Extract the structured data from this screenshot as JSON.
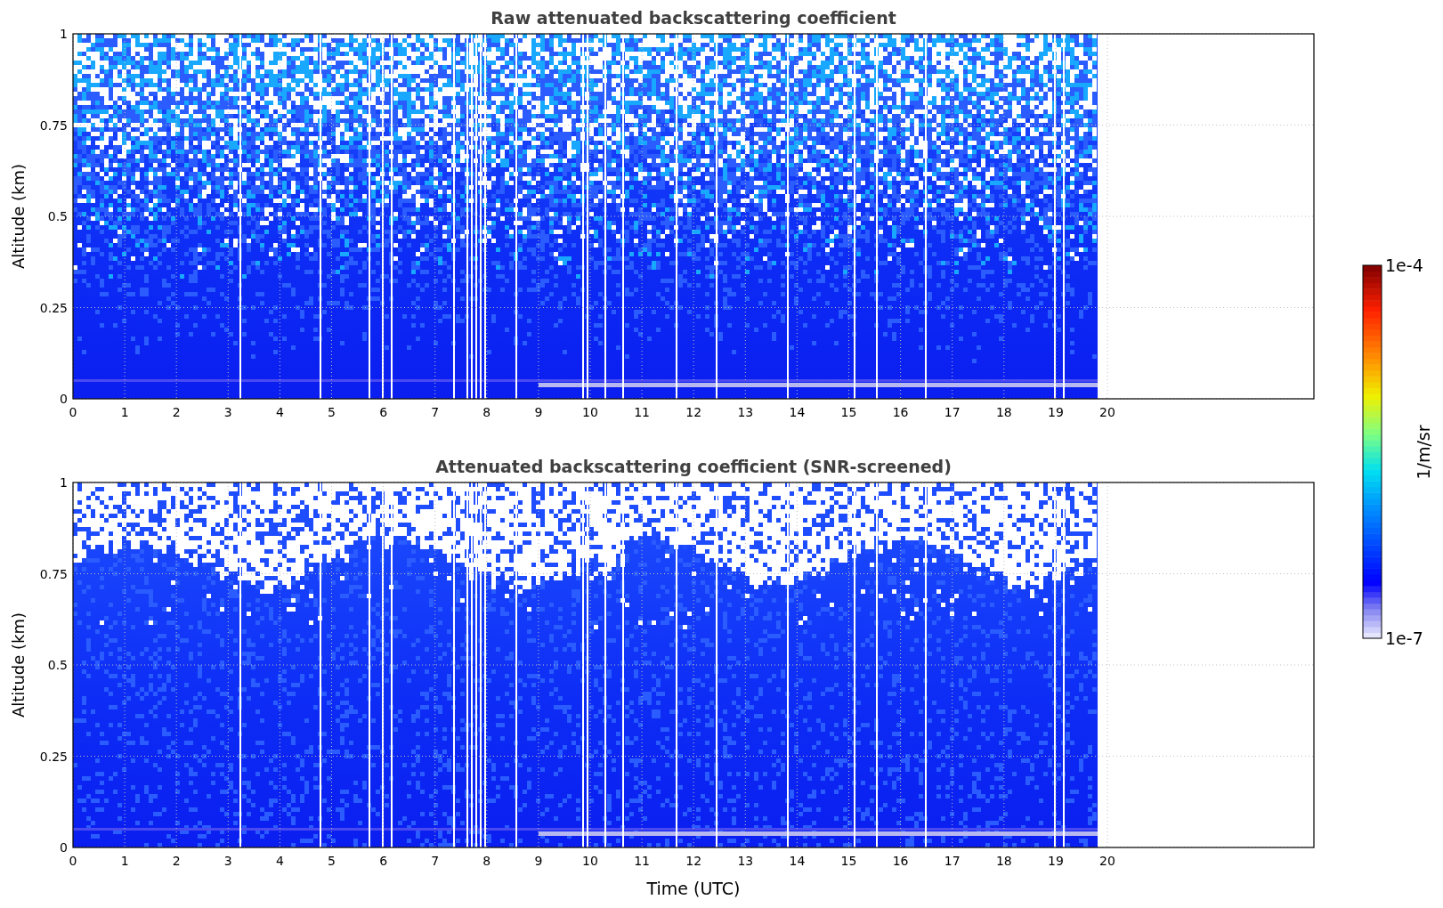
{
  "panels": [
    {
      "kind": "raw",
      "title": "Raw attenuated backscattering coefficient",
      "ylabel": "Altitude (km)",
      "yticks": [
        "1",
        "0.75",
        "0.5",
        "0.25",
        "0"
      ],
      "xticks": [
        "0",
        "1",
        "2",
        "3",
        "4",
        "5",
        "6",
        "7",
        "8",
        "9",
        "10",
        "11",
        "12",
        "13",
        "14",
        "15",
        "16",
        "17",
        "18",
        "19",
        "20"
      ]
    },
    {
      "kind": "screened",
      "title": "Attenuated backscattering coefficient (SNR-screened)",
      "ylabel": "Altitude (km)",
      "yticks": [
        "1",
        "0.75",
        "0.5",
        "0.25",
        "0"
      ],
      "xticks": [
        "0",
        "1",
        "2",
        "3",
        "4",
        "5",
        "6",
        "7",
        "8",
        "9",
        "10",
        "11",
        "12",
        "13",
        "14",
        "15",
        "16",
        "17",
        "18",
        "19",
        "20"
      ]
    }
  ],
  "xlabel": "Time (UTC)",
  "colorbar": {
    "max_label": "1e-4",
    "min_label": "1e-7",
    "unit": "1/m/sr"
  }
}
